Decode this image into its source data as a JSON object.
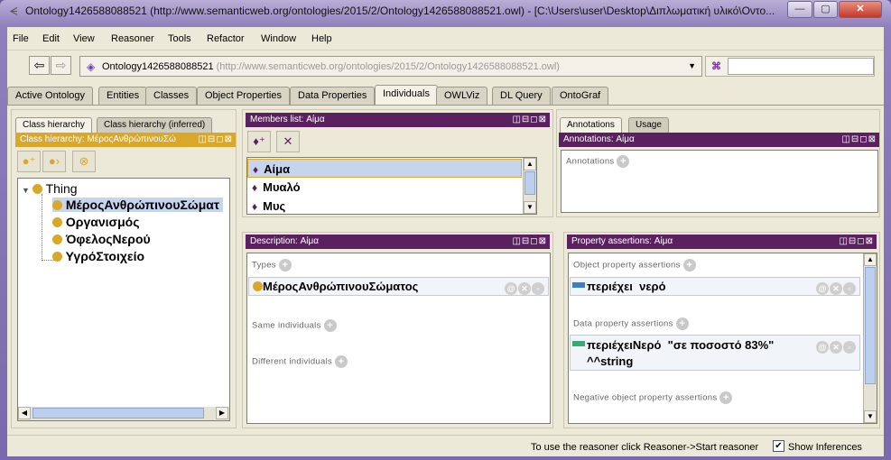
{
  "window": {
    "title": "Ontology1426588088521 (http://www.semanticweb.org/ontologies/2015/2/Ontology1426588088521.owl) - [C:\\Users\\user\\Desktop\\Διπλωματική υλικό\\Οντο...",
    "minimize": "—",
    "maximize": "▢",
    "close": "✕"
  },
  "menu": [
    "File",
    "Edit",
    "View",
    "Reasoner",
    "Tools",
    "Refactor",
    "Window",
    "Help"
  ],
  "nav": {
    "back_icon": "⇦",
    "forward_icon": "⇨",
    "ontology_name": "Ontology1426588088521",
    "ontology_iri": " (http://www.semanticweb.org/ontologies/2015/2/Ontology1426588088521.owl)",
    "dropdown_icon": "▼",
    "search_icon": "👓",
    "search_value": ""
  },
  "tabs": [
    "Active Ontology",
    "Entities",
    "Classes",
    "Object Properties",
    "Data Properties",
    "Individuals",
    "OWLViz",
    "DL Query",
    "OntoGraf"
  ],
  "active_tab": "Individuals",
  "class_panel": {
    "subtabs": [
      "Class hierarchy",
      "Class hierarchy (inferred)"
    ],
    "header": "Class hierarchy: ΜέροςΑνθρώπινουΣώ",
    "header_ctrls": "◫⊟◻⊠",
    "tools": [
      "add-subclass",
      "add-sibling",
      "delete-class"
    ],
    "root": "Thing",
    "children": [
      "ΜέροςΑνθρώπινουΣώματ",
      "Οργανισμός",
      "ΌφελοςΝερού",
      "ΥγρόΣτοιχείο"
    ],
    "selected": "ΜέροςΑνθρώπινουΣώματ"
  },
  "members_panel": {
    "header": "Members list: Αίμα",
    "header_ctrls": "◫⊟◻⊠",
    "items": [
      "Αίμα",
      "Μυαλό",
      "Μυς"
    ],
    "selected": "Αίμα"
  },
  "annotations_panel": {
    "subtabs": [
      "Annotations",
      "Usage"
    ],
    "header": "Annotations: Αίμα",
    "header_ctrls": "◫⊟◻⊠",
    "section": "Annotations"
  },
  "description_panel": {
    "header": "Description: Αίμα",
    "header_ctrls": "◫⊟◻⊠",
    "types_label": "Types",
    "types": [
      "ΜέροςΑνθρώπινουΣώματος"
    ],
    "same_label": "Same individuals",
    "different_label": "Different individuals"
  },
  "property_panel": {
    "header": "Property assertions: Αίμα",
    "header_ctrls": "◫⊟◻⊠",
    "object_label": "Object property assertions",
    "object_assertions": [
      "περιέχει  νερό"
    ],
    "data_label": "Data property assertions",
    "data_assertions": [
      {
        "line1": "περιέχειΝερό  \"σε ποσοστό 83%\"",
        "line2": "^^string"
      }
    ],
    "negative_label": "Negative object property assertions",
    "object_color": "#3d7fc4",
    "data_color": "#3aaa70"
  },
  "status": {
    "message": "To use the reasoner click Reasoner->Start reasoner",
    "show_inferences_label": "Show Inferences",
    "show_inferences_checked": true
  }
}
